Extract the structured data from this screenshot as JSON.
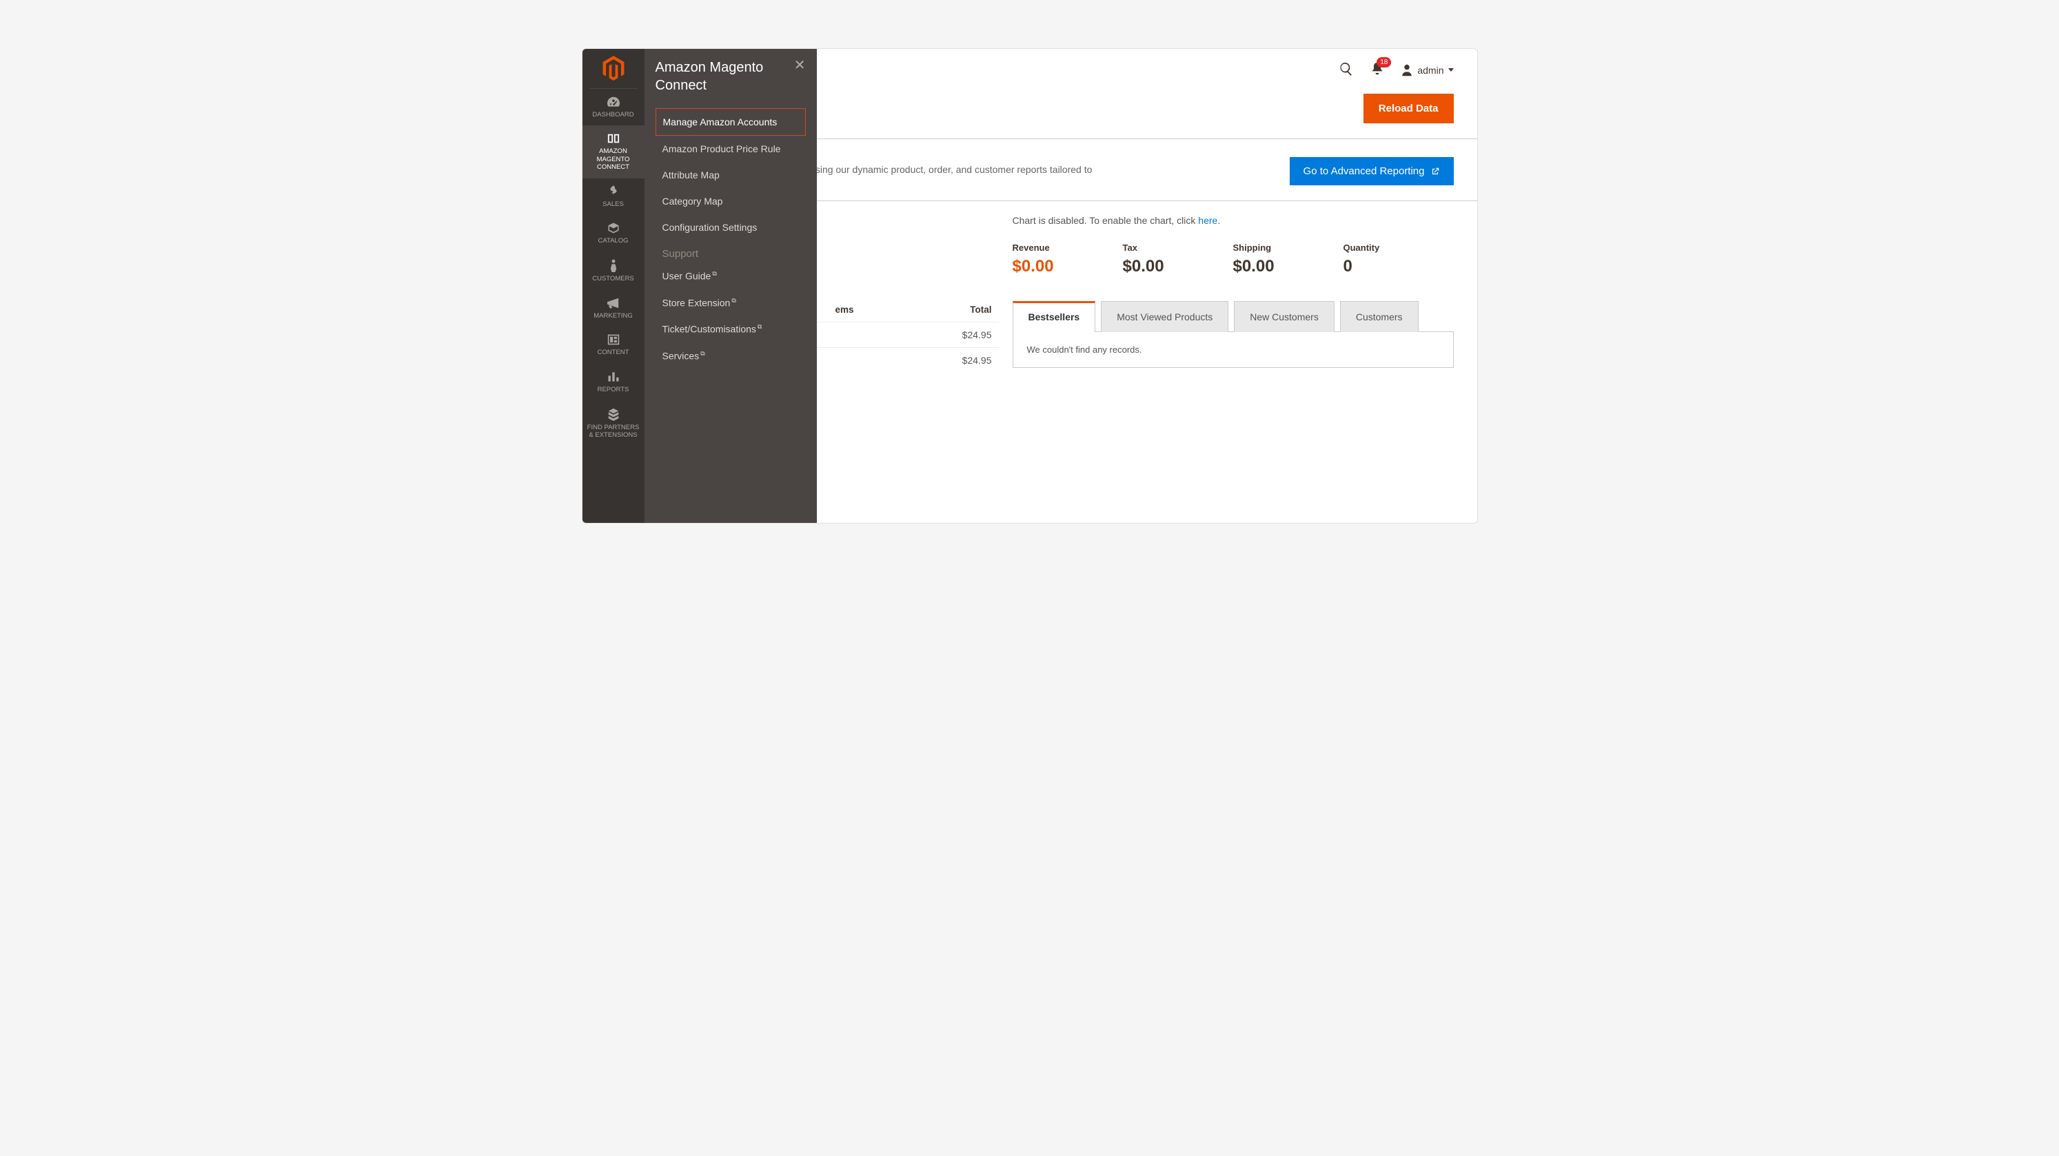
{
  "sidebar": {
    "items": [
      {
        "label": "DASHBOARD"
      },
      {
        "label": "AMAZON MAGENTO CONNECT"
      },
      {
        "label": "SALES"
      },
      {
        "label": "CATALOG"
      },
      {
        "label": "CUSTOMERS"
      },
      {
        "label": "MARKETING"
      },
      {
        "label": "CONTENT"
      },
      {
        "label": "REPORTS"
      },
      {
        "label": "FIND PARTNERS & EXTENSIONS"
      }
    ]
  },
  "flyout": {
    "title": "Amazon Magento Connect",
    "items": [
      {
        "label": "Manage Amazon Accounts"
      },
      {
        "label": "Amazon Product Price Rule"
      },
      {
        "label": "Attribute Map"
      },
      {
        "label": "Category Map"
      },
      {
        "label": "Configuration Settings"
      }
    ],
    "support_head": "Support",
    "support_items": [
      {
        "label": "User Guide"
      },
      {
        "label": "Store Extension"
      },
      {
        "label": "Ticket/Customisations"
      },
      {
        "label": "Services"
      }
    ]
  },
  "header": {
    "notif_count": "18",
    "admin_label": "admin"
  },
  "toolbar": {
    "reload_label": "Reload Data"
  },
  "adv": {
    "text_suffix": "d of your business' performance, using our dynamic product, order, and customer reports tailored to",
    "button_label": "Go to Advanced Reporting"
  },
  "chart_note": {
    "prefix": "Chart is disabled. To enable the chart, click ",
    "link": "here",
    "suffix": "."
  },
  "stats": [
    {
      "label": "Revenue",
      "value": "$0.00",
      "accent": true
    },
    {
      "label": "Tax",
      "value": "$0.00"
    },
    {
      "label": "Shipping",
      "value": "$0.00"
    },
    {
      "label": "Quantity",
      "value": "0"
    }
  ],
  "tabs": {
    "items": [
      {
        "label": "Bestsellers"
      },
      {
        "label": "Most Viewed Products"
      },
      {
        "label": "New Customers"
      },
      {
        "label": "Customers"
      }
    ],
    "empty_text": "We couldn't find any records."
  },
  "left_table": {
    "headers": {
      "items": "ems",
      "total": "Total"
    },
    "rows": [
      {
        "total": "$24.95"
      },
      {
        "total": "$24.95"
      }
    ]
  }
}
